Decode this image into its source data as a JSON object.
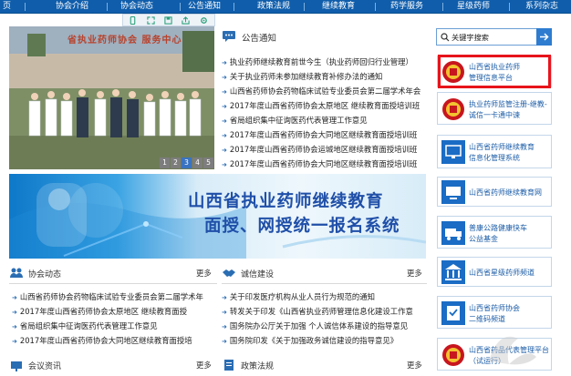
{
  "nav": {
    "items": [
      "页",
      "协会介绍",
      "协会动态",
      "公告通知",
      "政策法规",
      "继续教育",
      "药学服务",
      "星级药师",
      "系列杂志"
    ]
  },
  "slideshow": {
    "caption_visible": "省执业药师协会 服务中心",
    "pages": [
      "1",
      "2",
      "3",
      "4",
      "5"
    ],
    "active_page": "3"
  },
  "notice": {
    "title": "公告通知",
    "items": [
      "执业药师继续教育前世今生（执业药师回归行业管理）",
      "关于执业药师未参加继续教育补修办法的通知",
      "山西省药师协会药物临床试验专业委员会第二届学术年会",
      "2017年度山西省药师协会太原地区 继续教育面授培训班",
      "省局组织集中征询医药代表管理工作意见",
      "2017年度山西省药师协会大同地区继续教育面授培训班",
      "2017年度山西省药师协会运城地区继续教育面授培训班",
      "2017年度山西省药师协会大同地区继续教育面授培训班"
    ]
  },
  "banner": {
    "line1": "山西省执业药师继续教育",
    "line2": "面授、网授统一报名系统"
  },
  "association": {
    "title": "协会动态",
    "more": "更多",
    "items": [
      "山西省药师协会药物临床试验专业委员会第二届学术年",
      "2017年度山西省药师协会太原地区 继续教育面授",
      "省局组织集中征询医药代表管理工作意见",
      "2017年度山西省药师协会大同地区继续教育面授培"
    ]
  },
  "credit": {
    "title": "诚信建设",
    "more": "更多",
    "items": [
      "关于印发医疗机构从业人员行为规范的通知",
      "转发关于印发《山西省执业药师管理信息化建设工作意",
      "国务院办公厅关于加强 个人诚信体系建设的指导意见",
      "国务院印发《关于加强政务诚信建设的指导意见》"
    ]
  },
  "meeting": {
    "title": "会议资讯",
    "more": "更多"
  },
  "policy": {
    "title": "政策法规",
    "more": "更多"
  },
  "search": {
    "placeholder": "关键字搜索"
  },
  "side_cards": [
    {
      "line1": "山西省执业药师",
      "line2": "管理信息平台"
    },
    {
      "line1": "执业药师监管注册-继教-",
      "line2": "诚信一卡通中谏"
    },
    {
      "line1": "山西省药师继续教育",
      "line2": "信息化管理系统"
    },
    {
      "line1": "山西省药师继续教育网",
      "line2": ""
    },
    {
      "line1": "普康公路健康快车",
      "line2": "公益基金"
    },
    {
      "line1": "山西省星级药师频道",
      "line2": ""
    },
    {
      "line1": "山西省药师协会",
      "line2": "二维码频道"
    },
    {
      "line1": "山西省药品代表管理平台",
      "line2": "（试运行）"
    }
  ],
  "colors": {
    "nav": "#0f5dab",
    "accent": "#1d5ea8",
    "highlight": "#e8141b"
  }
}
